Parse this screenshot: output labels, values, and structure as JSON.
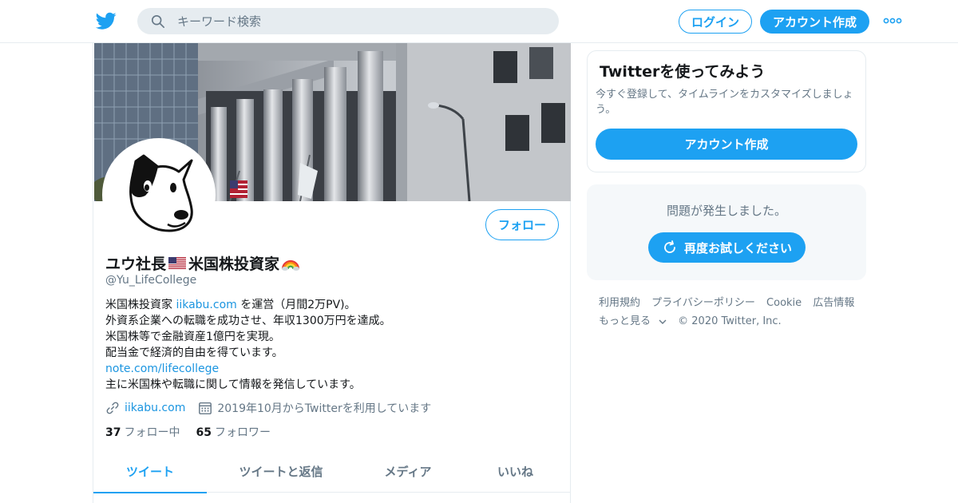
{
  "header": {
    "search_placeholder": "キーワード検索",
    "login_label": "ログイン",
    "signup_label": "アカウント作成"
  },
  "profile": {
    "name_part1": "ユウ社長",
    "name_part2": "米国株投資家",
    "handle": "@Yu_LifeCollege",
    "follow_label": "フォロー",
    "bio": {
      "line1_prefix": "米国株投資家 ",
      "line1_link": "iikabu.com",
      "line1_suffix": " を運営（月間2万PV)。",
      "line2": "外資系企業への転職を成功させ、年収1300万円を達成。",
      "line3": "米国株等で金融資産1億円を実現。",
      "line4": "配当金で経済的自由を得ています。",
      "line5_link": "note.com/lifecollege",
      "line6": "主に米国株や転職に関して情報を発信しています。"
    },
    "website": "iikabu.com",
    "joined": "2019年10月からTwitterを利用しています",
    "following_count": "37",
    "following_label": "フォロー中",
    "followers_count": "65",
    "followers_label": "フォロワー",
    "tabs": [
      {
        "label": "ツイート",
        "active": true
      },
      {
        "label": "ツイートと返信",
        "active": false
      },
      {
        "label": "メディア",
        "active": false
      },
      {
        "label": "いいね",
        "active": false
      }
    ]
  },
  "sidebar": {
    "try_title": "Twitterを使ってみよう",
    "try_text": "今すぐ登録して、タイムラインをカスタマイズしましょう。",
    "try_button": "アカウント作成",
    "error_text": "問題が発生しました。",
    "retry_label": "再度お試しください"
  },
  "footer": {
    "terms": "利用規約",
    "privacy": "プライバシーポリシー",
    "cookie": "Cookie",
    "ads": "広告情報",
    "more": "もっと見る",
    "copyright": "© 2020 Twitter, Inc."
  },
  "colors": {
    "accent": "#1da1f2",
    "link": "#1b95e0",
    "secondary_text": "#657786",
    "border": "#e6ecf0"
  },
  "icons": [
    "twitter-bird-icon",
    "search-icon",
    "more-icon",
    "link-icon",
    "calendar-icon",
    "refresh-icon",
    "chevron-down-icon",
    "us-flag-icon",
    "rainbow-icon"
  ]
}
